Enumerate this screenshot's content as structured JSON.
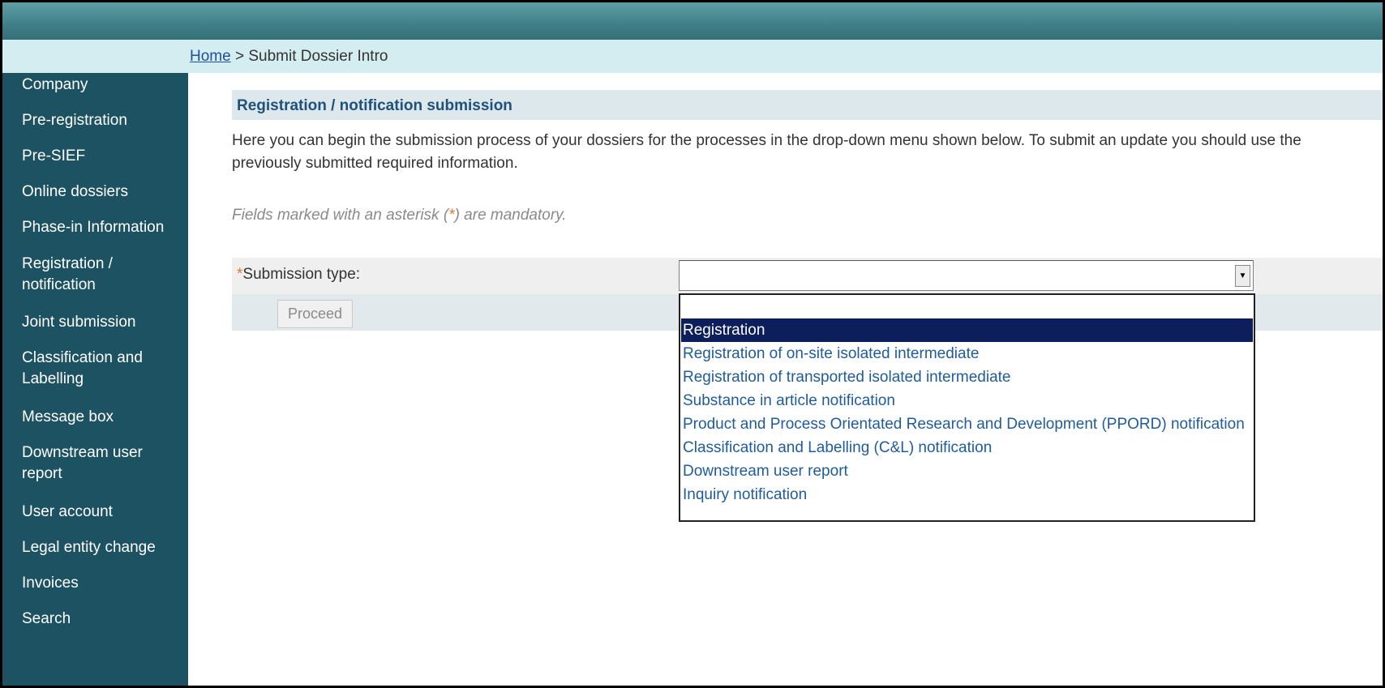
{
  "breadcrumb": {
    "home": "Home",
    "separator": " > ",
    "current": "Submit Dossier Intro"
  },
  "sidebar": {
    "items": [
      {
        "label": "Company"
      },
      {
        "label": "Pre-registration"
      },
      {
        "label": "Pre-SIEF"
      },
      {
        "label": "Online dossiers"
      },
      {
        "label": "Phase-in Information"
      },
      {
        "label": "Registration / notification"
      },
      {
        "label": "Joint submission"
      },
      {
        "label": "Classification and Labelling"
      },
      {
        "label": "Message box"
      },
      {
        "label": "Downstream user report"
      },
      {
        "label": "User account"
      },
      {
        "label": "Legal entity change"
      },
      {
        "label": "Invoices"
      },
      {
        "label": "Search"
      }
    ]
  },
  "main": {
    "title": "Registration / notification submission",
    "intro_line1": "Here you can begin the submission process of your dossiers for the processes in the drop-down menu shown below. To submit an update you should use the",
    "intro_line2": "previously submitted required information.",
    "mandatory_pre": "Fields marked with an asterisk (",
    "mandatory_star": "*",
    "mandatory_post": ") are mandatory.",
    "form": {
      "required_star": "*",
      "submission_type_label": "Submission type:",
      "submission_type_value": "",
      "proceed_label": "Proceed",
      "options": [
        "",
        "Registration",
        "Registration of on-site isolated intermediate",
        "Registration of transported isolated intermediate",
        "Substance in article notification",
        "Product and Process Orientated Research and Development (PPORD) notification",
        "Classification and Labelling (C&L) notification",
        "Downstream user report",
        "Inquiry notification"
      ],
      "highlighted_option": "Registration"
    }
  },
  "colors": {
    "sidebar_bg": "#1d5262",
    "topbar": "#3f7f87",
    "breadcrumb_bg": "#d4edf1",
    "title_color": "#20517a",
    "link_color": "#1f5c9a",
    "selected_bg": "#0c1f5c",
    "asterisk": "#e07b22"
  }
}
